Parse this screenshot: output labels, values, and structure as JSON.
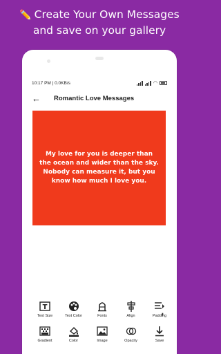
{
  "promo": {
    "line1": "Create  Your Own Messages",
    "line2": "and save on your gallery"
  },
  "status": {
    "time_speed": "10:17 PM | 0.0KB/s",
    "battery": "battery-icon"
  },
  "appbar": {
    "back_icon": "back-arrow-icon",
    "title": "Romantic Love Messages"
  },
  "card": {
    "background": "#f03a1c",
    "message": "My love for you is deeper than the ocean and wider than the sky. Nobody can measure it, but you know how much I love you."
  },
  "toolbar_row1": [
    {
      "label": "Text Size",
      "icon": "text-size-icon"
    },
    {
      "label": "Text Color",
      "icon": "palette-icon"
    },
    {
      "label": "Fonts",
      "icon": "fonts-icon"
    },
    {
      "label": "Align",
      "icon": "align-icon"
    },
    {
      "label": "Padding",
      "icon": "padding-icon"
    }
  ],
  "toolbar_row2": [
    {
      "label": "Gradient",
      "icon": "gradient-icon"
    },
    {
      "label": "Color",
      "icon": "color-fill-icon"
    },
    {
      "label": "Image",
      "icon": "image-icon"
    },
    {
      "label": "Opacity",
      "icon": "opacity-icon"
    },
    {
      "label": "Save",
      "icon": "save-icon"
    }
  ],
  "colors": {
    "background": "#8a2aa3",
    "card": "#f03a1c"
  }
}
